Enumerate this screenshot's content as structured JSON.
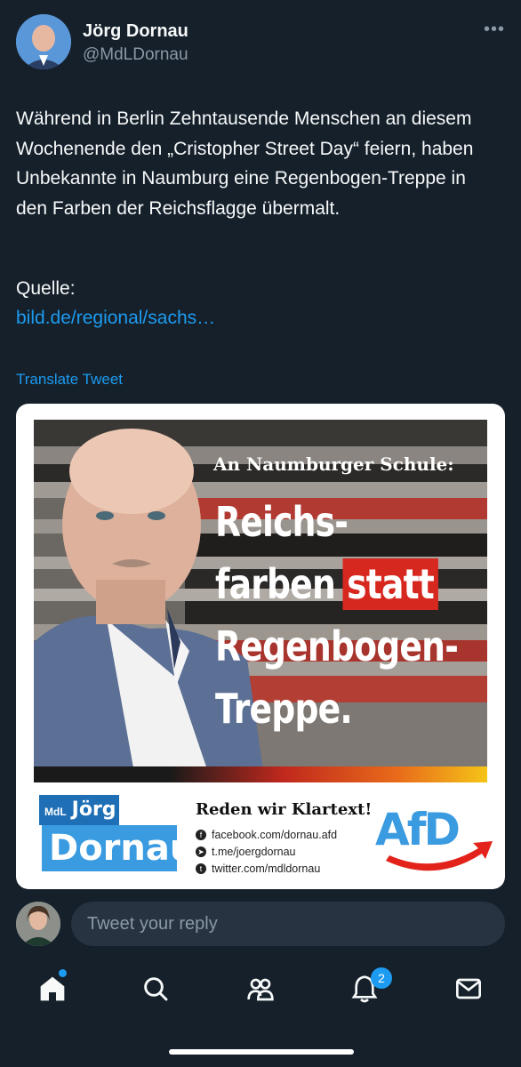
{
  "author": {
    "name": "Jörg Dornau",
    "handle": "@MdLDornau"
  },
  "tweet": {
    "text": "Während in Berlin Zehntausende Menschen an diesem Wochenende den „Cristopher Street Day“ feiern, haben Unbekannte in Naumburg eine Regenbogen-Treppe in den Farben der Reichsflagge übermalt.",
    "source_label": "Quelle:",
    "link": "bild.de/regional/sachs…",
    "translate": "Translate Tweet"
  },
  "media": {
    "subheadline": "An Naumburger Schule:",
    "headline_1": "Reichs-",
    "headline_2a": "farben",
    "headline_2b": "statt",
    "headline_3": "Regenbogen-",
    "headline_4": "Treppe.",
    "mdl": "MdL",
    "first_name": "Jörg",
    "last_name": "Dornau",
    "claim": "Reden wir Klartext!",
    "socials": [
      {
        "icon": "facebook-icon",
        "text": "facebook.com/dornau.afd"
      },
      {
        "icon": "telegram-icon",
        "text": "t.me/joergdornau"
      },
      {
        "icon": "twitter-icon",
        "text": "twitter.com/mdldornau"
      }
    ],
    "party_logo": "AfD"
  },
  "reply": {
    "placeholder": "Tweet your reply"
  },
  "nav": {
    "items": [
      "home-icon",
      "search-icon",
      "communities-icon",
      "notifications-icon",
      "messages-icon"
    ],
    "notifications_badge": "2"
  },
  "colors": {
    "background": "#15202b",
    "accent": "#1d9bf0",
    "headline_red": "#d7281f",
    "afd_blue": "#3b9be0"
  }
}
